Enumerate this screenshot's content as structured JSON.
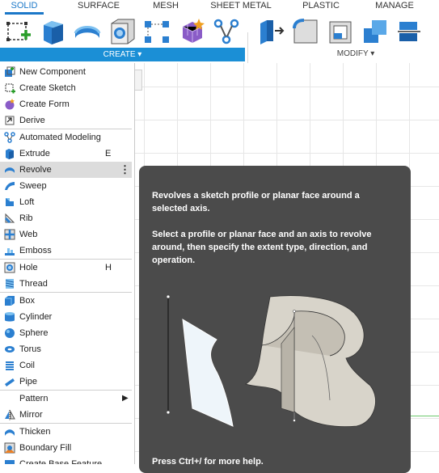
{
  "tabs": [
    "SOLID",
    "SURFACE",
    "MESH",
    "SHEET METAL",
    "PLASTIC",
    "MANAGE"
  ],
  "active_tab": "SOLID",
  "toolbar": {
    "create_label": "CREATE",
    "create_arrow": "▾",
    "modify_label": "MODIFY",
    "modify_arrow": "▾",
    "create_tools": [
      "new-sketch-icon",
      "extrude-icon",
      "revolve-icon",
      "hole-icon",
      "pattern-icon",
      "form-icon",
      "automated-modeling-icon"
    ],
    "modify_tools": [
      "press-pull-icon",
      "fillet-icon",
      "shell-icon",
      "combine-icon",
      "align-icon"
    ]
  },
  "menu": {
    "items": [
      {
        "label": "New Component",
        "icon": "new-component-icon"
      },
      {
        "label": "Create Sketch",
        "icon": "sketch-icon"
      },
      {
        "label": "Create Form",
        "icon": "form-icon"
      },
      {
        "label": "Derive",
        "icon": "derive-icon"
      },
      {
        "label": "Automated Modeling",
        "icon": "automated-modeling-icon"
      },
      {
        "label": "Extrude",
        "icon": "extrude-icon",
        "shortcut": "E"
      },
      {
        "label": "Revolve",
        "icon": "revolve-icon",
        "more": "⋮"
      },
      {
        "label": "Sweep",
        "icon": "sweep-icon"
      },
      {
        "label": "Loft",
        "icon": "loft-icon"
      },
      {
        "label": "Rib",
        "icon": "rib-icon"
      },
      {
        "label": "Web",
        "icon": "web-icon"
      },
      {
        "label": "Emboss",
        "icon": "emboss-icon"
      },
      {
        "label": "Hole",
        "icon": "hole-icon",
        "shortcut": "H"
      },
      {
        "label": "Thread",
        "icon": "thread-icon"
      },
      {
        "label": "Box",
        "icon": "box-icon"
      },
      {
        "label": "Cylinder",
        "icon": "cylinder-icon"
      },
      {
        "label": "Sphere",
        "icon": "sphere-icon"
      },
      {
        "label": "Torus",
        "icon": "torus-icon"
      },
      {
        "label": "Coil",
        "icon": "coil-icon"
      },
      {
        "label": "Pipe",
        "icon": "pipe-icon"
      },
      {
        "label": "Pattern",
        "icon": "",
        "submenu": "▶"
      },
      {
        "label": "Mirror",
        "icon": "mirror-icon"
      },
      {
        "label": "Thicken",
        "icon": "thicken-icon"
      },
      {
        "label": "Boundary Fill",
        "icon": "boundary-fill-icon"
      },
      {
        "label": "Create Base Feature",
        "icon": "base-feature-icon"
      }
    ],
    "highlighted": "Revolve"
  },
  "tooltip": {
    "summary": "Revolves a sketch profile or planar face around a selected axis.",
    "detail": "Select a profile or planar face and an axis to revolve around, then specify the extent type, direction, and operation.",
    "footer": "Press Ctrl+/ for more help."
  },
  "colors": {
    "accent": "#1b78c8",
    "create_bar": "#1b8fd6",
    "tooltip_bg": "#4b4b4b",
    "highlight": "#dcdcdc"
  }
}
